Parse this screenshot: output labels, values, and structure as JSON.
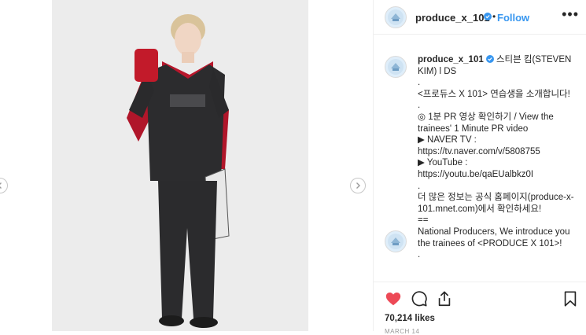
{
  "post": {
    "username": "produce_x_101",
    "follow_label": "Follow",
    "more_label": "•••",
    "dot": "•"
  },
  "caption": {
    "username": "produce_x_101",
    "text": " 스티븐 킴(STEVEN KIM) l DS\n.\n<프로듀스 X 101> 연습생을 소개합니다!\n.\n◎ 1분 PR 영상 확인하기 / View the trainees' 1 Minute PR video\n▶ NAVER TV :\nhttps://tv.naver.com/v/5808755\n▶ YouTube :\nhttps://youtu.be/qaEUalbkz0I\n.\n더 많은 정보는 공식 홈페이지(produce-x-101.mnet.com)에서 확인하세요!\n==\nNational Producers, We introduce you the trainees of <PRODUCE X 101>!\n."
  },
  "actions": {
    "likes": "70,214 likes",
    "timestamp": "MARCH 14"
  },
  "colors": {
    "accent": "#3897f0",
    "like": "#ed4956",
    "verified": "#3897f0"
  },
  "icons": [
    "chevron-left-icon",
    "chevron-right-icon",
    "verified-icon",
    "heart-icon",
    "comment-icon",
    "share-icon",
    "bookmark-icon",
    "more-icon"
  ]
}
